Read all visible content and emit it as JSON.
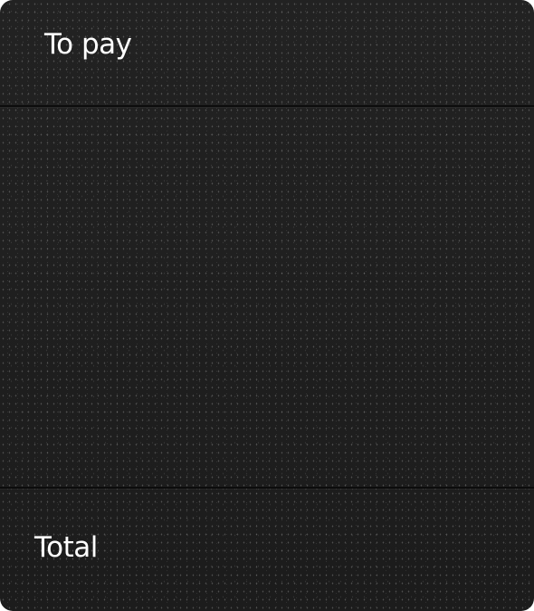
{
  "header": {
    "title": "To pay"
  },
  "footer": {
    "total_label": "Total"
  },
  "colors": {
    "panel_background": "#1e1e1e",
    "text": "#ffffff",
    "divider": "#0c0c0c"
  }
}
